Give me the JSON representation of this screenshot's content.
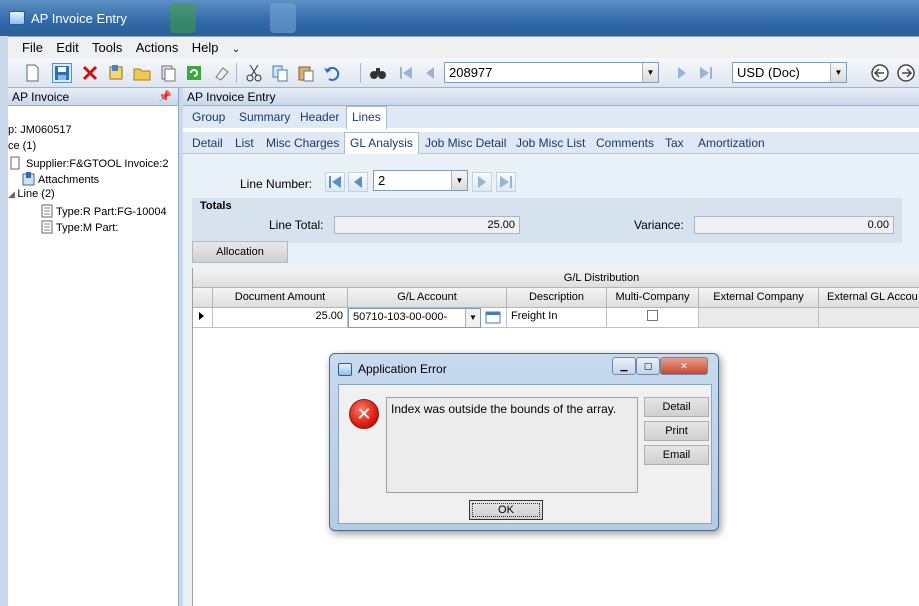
{
  "window": {
    "title": "AP Invoice Entry"
  },
  "menu": {
    "items": [
      "File",
      "Edit",
      "Tools",
      "Actions",
      "Help"
    ],
    "overflow": "⌄"
  },
  "toolbar": {
    "invoice_number": "208977",
    "currency": "USD (Doc)"
  },
  "left_panel": {
    "title": "AP Invoice",
    "pin": "📌",
    "tree": [
      {
        "text": "p: JM060517"
      },
      {
        "text": "ce (1)"
      },
      {
        "text": "Supplier:F&GTOOL Invoice:2"
      },
      {
        "text": "Attachments"
      },
      {
        "text": "Line (2)"
      },
      {
        "text": "Type:R Part:FG-10004"
      },
      {
        "text": "Type:M Part:"
      }
    ]
  },
  "main_panel": {
    "title": "AP Invoice Entry",
    "tabs_top": [
      "Group",
      "Summary",
      "Header",
      "Lines"
    ],
    "tabs_sub": [
      "Detail",
      "List",
      "Misc Charges",
      "GL Analysis",
      "Job Misc Detail",
      "Job Misc List",
      "Comments",
      "Tax",
      "Amortization"
    ],
    "line_number_label": "Line Number:",
    "line_number_value": "2",
    "totals_label": "Totals",
    "line_total_label": "Line Total:",
    "line_total_value": "25.00",
    "variance_label": "Variance:",
    "variance_value": "0.00",
    "allocation_label": "Allocation",
    "grid": {
      "group_header": "G/L Distribution",
      "columns": [
        "Document Amount",
        "G/L Account",
        "Description",
        "Multi-Company",
        "External Company",
        "External GL Accou"
      ],
      "row": {
        "document_amount": "25.00",
        "gl_account": "50710-103-00-000-",
        "description": "Freight In"
      }
    }
  },
  "dialog": {
    "title": "Application Error",
    "message": "Index was outside the bounds of the array.",
    "buttons": {
      "detail": "Detail",
      "print": "Print",
      "email": "Email",
      "ok": "OK"
    }
  }
}
